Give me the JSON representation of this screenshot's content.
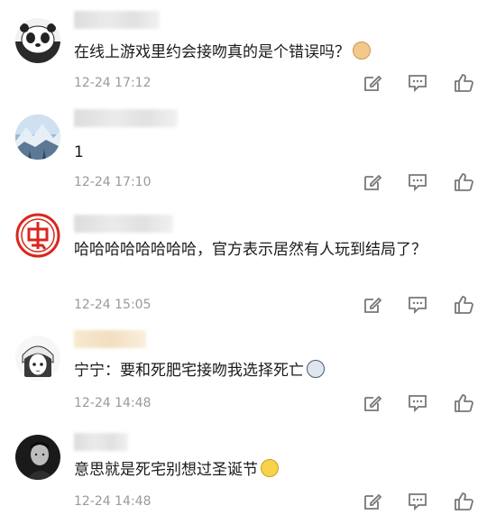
{
  "comments": [
    {
      "text": "在线上游戏里约会接吻真的是个错误吗？",
      "time": "12-24 17:12",
      "emoji": "cat-emoji",
      "avatar": "panda-avatar"
    },
    {
      "text": "1",
      "time": "12-24 17:10",
      "avatar": "snow-mountain-avatar"
    },
    {
      "text": "哈哈哈哈哈哈哈哈，官方表示居然有人玩到结局了？",
      "time": "12-24 15:05",
      "avatar": "red-seal-avatar"
    },
    {
      "text": "宁宁：要和死肥宅接吻我选择死亡",
      "time": "12-24 14:48",
      "emoji": "husky-emoji",
      "avatar": "anime-girl-avatar"
    },
    {
      "text": "意思就是死宅别想过圣诞节",
      "time": "12-24 14:48",
      "emoji": "shh-emoji",
      "avatar": "man-portrait-avatar"
    }
  ],
  "icons": {
    "reply": "edit-icon",
    "comment": "comment-icon",
    "like": "thumbs-up-icon"
  },
  "colors": {
    "time": "#9a9a9a",
    "icon": "#7a7a7a",
    "seal_red": "#d9271c"
  }
}
